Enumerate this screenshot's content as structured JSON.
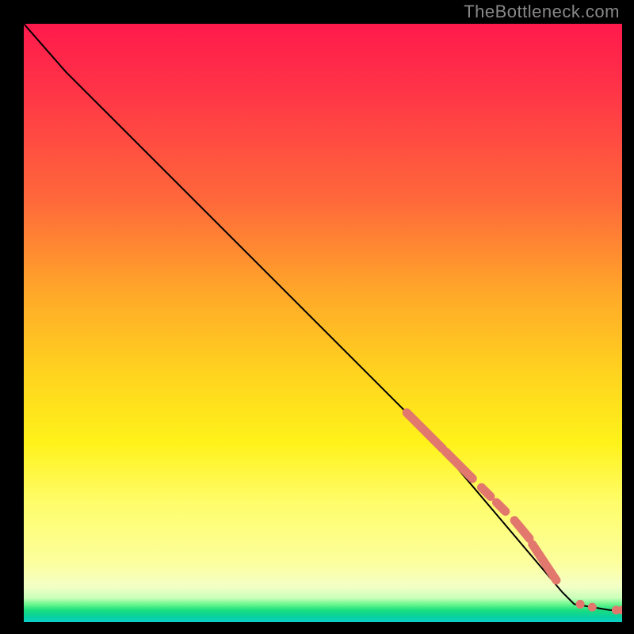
{
  "attribution": "TheBottleneck.com",
  "chart_data": {
    "type": "line",
    "title": "",
    "xlabel": "",
    "ylabel": "",
    "xlim": [
      0,
      100
    ],
    "ylim": [
      0,
      100
    ],
    "grid": false,
    "curve": [
      {
        "x": 0,
        "y": 100
      },
      {
        "x": 7,
        "y": 92
      },
      {
        "x": 12,
        "y": 87
      },
      {
        "x": 68,
        "y": 31
      },
      {
        "x": 90,
        "y": 5
      },
      {
        "x": 92,
        "y": 3
      },
      {
        "x": 98,
        "y": 2
      },
      {
        "x": 100,
        "y": 2
      }
    ],
    "marker_segments": [
      {
        "x1": 64,
        "y1": 35,
        "x2": 70,
        "y2": 29
      },
      {
        "x1": 70.5,
        "y1": 28.5,
        "x2": 75,
        "y2": 24
      },
      {
        "x1": 76.5,
        "y1": 22.5,
        "x2": 78,
        "y2": 21
      },
      {
        "x1": 79,
        "y1": 20,
        "x2": 80.5,
        "y2": 18.5
      },
      {
        "x1": 82,
        "y1": 17,
        "x2": 84.5,
        "y2": 14
      },
      {
        "x1": 85,
        "y1": 13,
        "x2": 89,
        "y2": 7
      }
    ],
    "marker_points": [
      {
        "x": 93,
        "y": 3
      },
      {
        "x": 95,
        "y": 2.5
      },
      {
        "x": 99,
        "y": 2
      },
      {
        "x": 100,
        "y": 2
      }
    ],
    "marker_radius_px": 5.5,
    "colors": {
      "line": "#000000",
      "marker": "#e2786d",
      "gradient_top": "#ff1a4c",
      "gradient_bottom": "#0ad1c8"
    }
  }
}
